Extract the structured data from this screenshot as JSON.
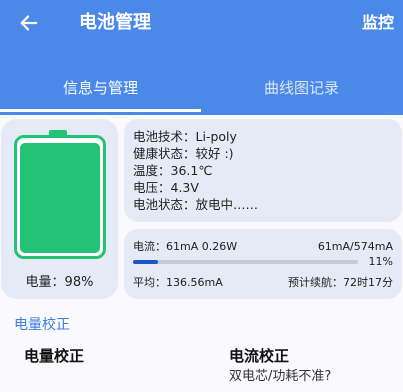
{
  "appbar": {
    "title": "电池管理",
    "monitor_label": "监控"
  },
  "tabs": [
    {
      "label": "信息与管理",
      "active": true
    },
    {
      "label": "曲线图记录",
      "active": false
    }
  ],
  "battery": {
    "charge_label": "电量：98%",
    "charge_fraction": 0.98,
    "fill_color": "#24c274"
  },
  "info": {
    "lines": [
      "电池技术：Li-poly",
      "健康状态：较好 :)",
      "温度：36.1℃",
      "电压：4.3V",
      "电池状态：放电中……"
    ]
  },
  "current": {
    "current_text": "电流：61mA  0.26W",
    "ratio_text": "61mA/574mA",
    "percent_text": "11%",
    "percent_value": 0.11,
    "average_text": "平均：136.56mA",
    "endurance_text": "预计续航：72时17分"
  },
  "calibration": {
    "section_title": "电量校正",
    "left_title": "电量校正",
    "right_title": "电流校正",
    "right_subtitle": "双电芯/功耗不准?"
  },
  "colors": {
    "appbar": "#4a89e8",
    "accent": "#3d7ee0",
    "battery_green": "#24c274",
    "progress": "#1a58c8"
  }
}
